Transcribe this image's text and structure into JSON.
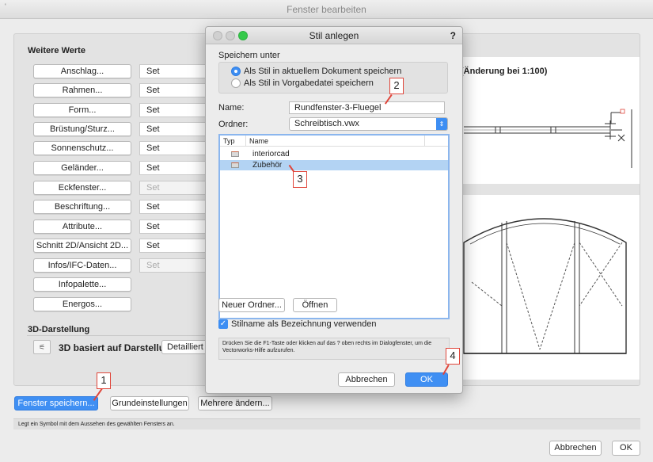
{
  "main_window": {
    "title": "Fenster bearbeiten",
    "group_label": "Weitere Werte",
    "rows": [
      {
        "label": "Anschlag...",
        "set": "Set",
        "set_disabled": false
      },
      {
        "label": "Rahmen...",
        "set": "Set",
        "set_disabled": false
      },
      {
        "label": "Form...",
        "set": "Set",
        "set_disabled": false
      },
      {
        "label": "Brüstung/Sturz...",
        "set": "Set",
        "set_disabled": false
      },
      {
        "label": "Sonnenschutz...",
        "set": "Set",
        "set_disabled": false
      },
      {
        "label": "Geländer...",
        "set": "Set",
        "set_disabled": false
      },
      {
        "label": "Eckfenster...",
        "set": "Set",
        "set_disabled": true
      },
      {
        "label": "Beschriftung...",
        "set": "Set",
        "set_disabled": false
      },
      {
        "label": "Attribute...",
        "set": "Set",
        "set_disabled": false
      },
      {
        "label": "Schnitt 2D/Ansicht 2D...",
        "set": "Set",
        "set_disabled": false
      },
      {
        "label": "Infos/IFC-Daten...",
        "set": "Set",
        "set_disabled": true
      },
      {
        "label": "Infopalette...",
        "set": null
      },
      {
        "label": "Energos...",
        "set": null
      }
    ],
    "section_3d": "3D-Darstellung",
    "label_3d": "3D basiert auf Darstellung:",
    "popup_3d": "Detailliert",
    "scale_label": "(Änderung bei 1:100)",
    "bottom_buttons": {
      "save": "Fenster speichern...",
      "basic": "Grundeinstellungen",
      "multi": "Mehrere ändern..."
    },
    "hint": "Legt ein Symbol mit dem Aussehen des gewählten Fensters an.",
    "cancel": "Abbrechen",
    "ok": "OK"
  },
  "dialog": {
    "title": "Stil anlegen",
    "help_glyph": "?",
    "save_under_label": "Speichern unter",
    "radio_current": "Als Stil in aktuellem Dokument speichern",
    "radio_default": "Als Stil in Vorgabedatei speichern",
    "name_label": "Name:",
    "name_value": "Rundfenster-3-Fluegel",
    "folder_label": "Ordner:",
    "folder_value": "Schreibtisch.vwx",
    "list_col_type": "Typ",
    "list_col_name": "Name",
    "list_items": [
      "interiorcad",
      "Zubehör"
    ],
    "new_folder": "Neuer Ordner...",
    "open": "Öffnen",
    "checkbox_label": "Stilname als Bezeichnung verwenden",
    "help_text": "Drücken Sie die F1-Taste oder klicken auf das ? oben rechts im Dialogfenster, um die Vectorworks-Hilfe aufzurufen.",
    "cancel": "Abbrechen",
    "ok": "OK"
  },
  "annotations": [
    "1",
    "2",
    "3",
    "4"
  ],
  "colors": {
    "accent": "#3d8ef3",
    "annotation": "#e0453a",
    "selection": "#b3d3f3"
  }
}
